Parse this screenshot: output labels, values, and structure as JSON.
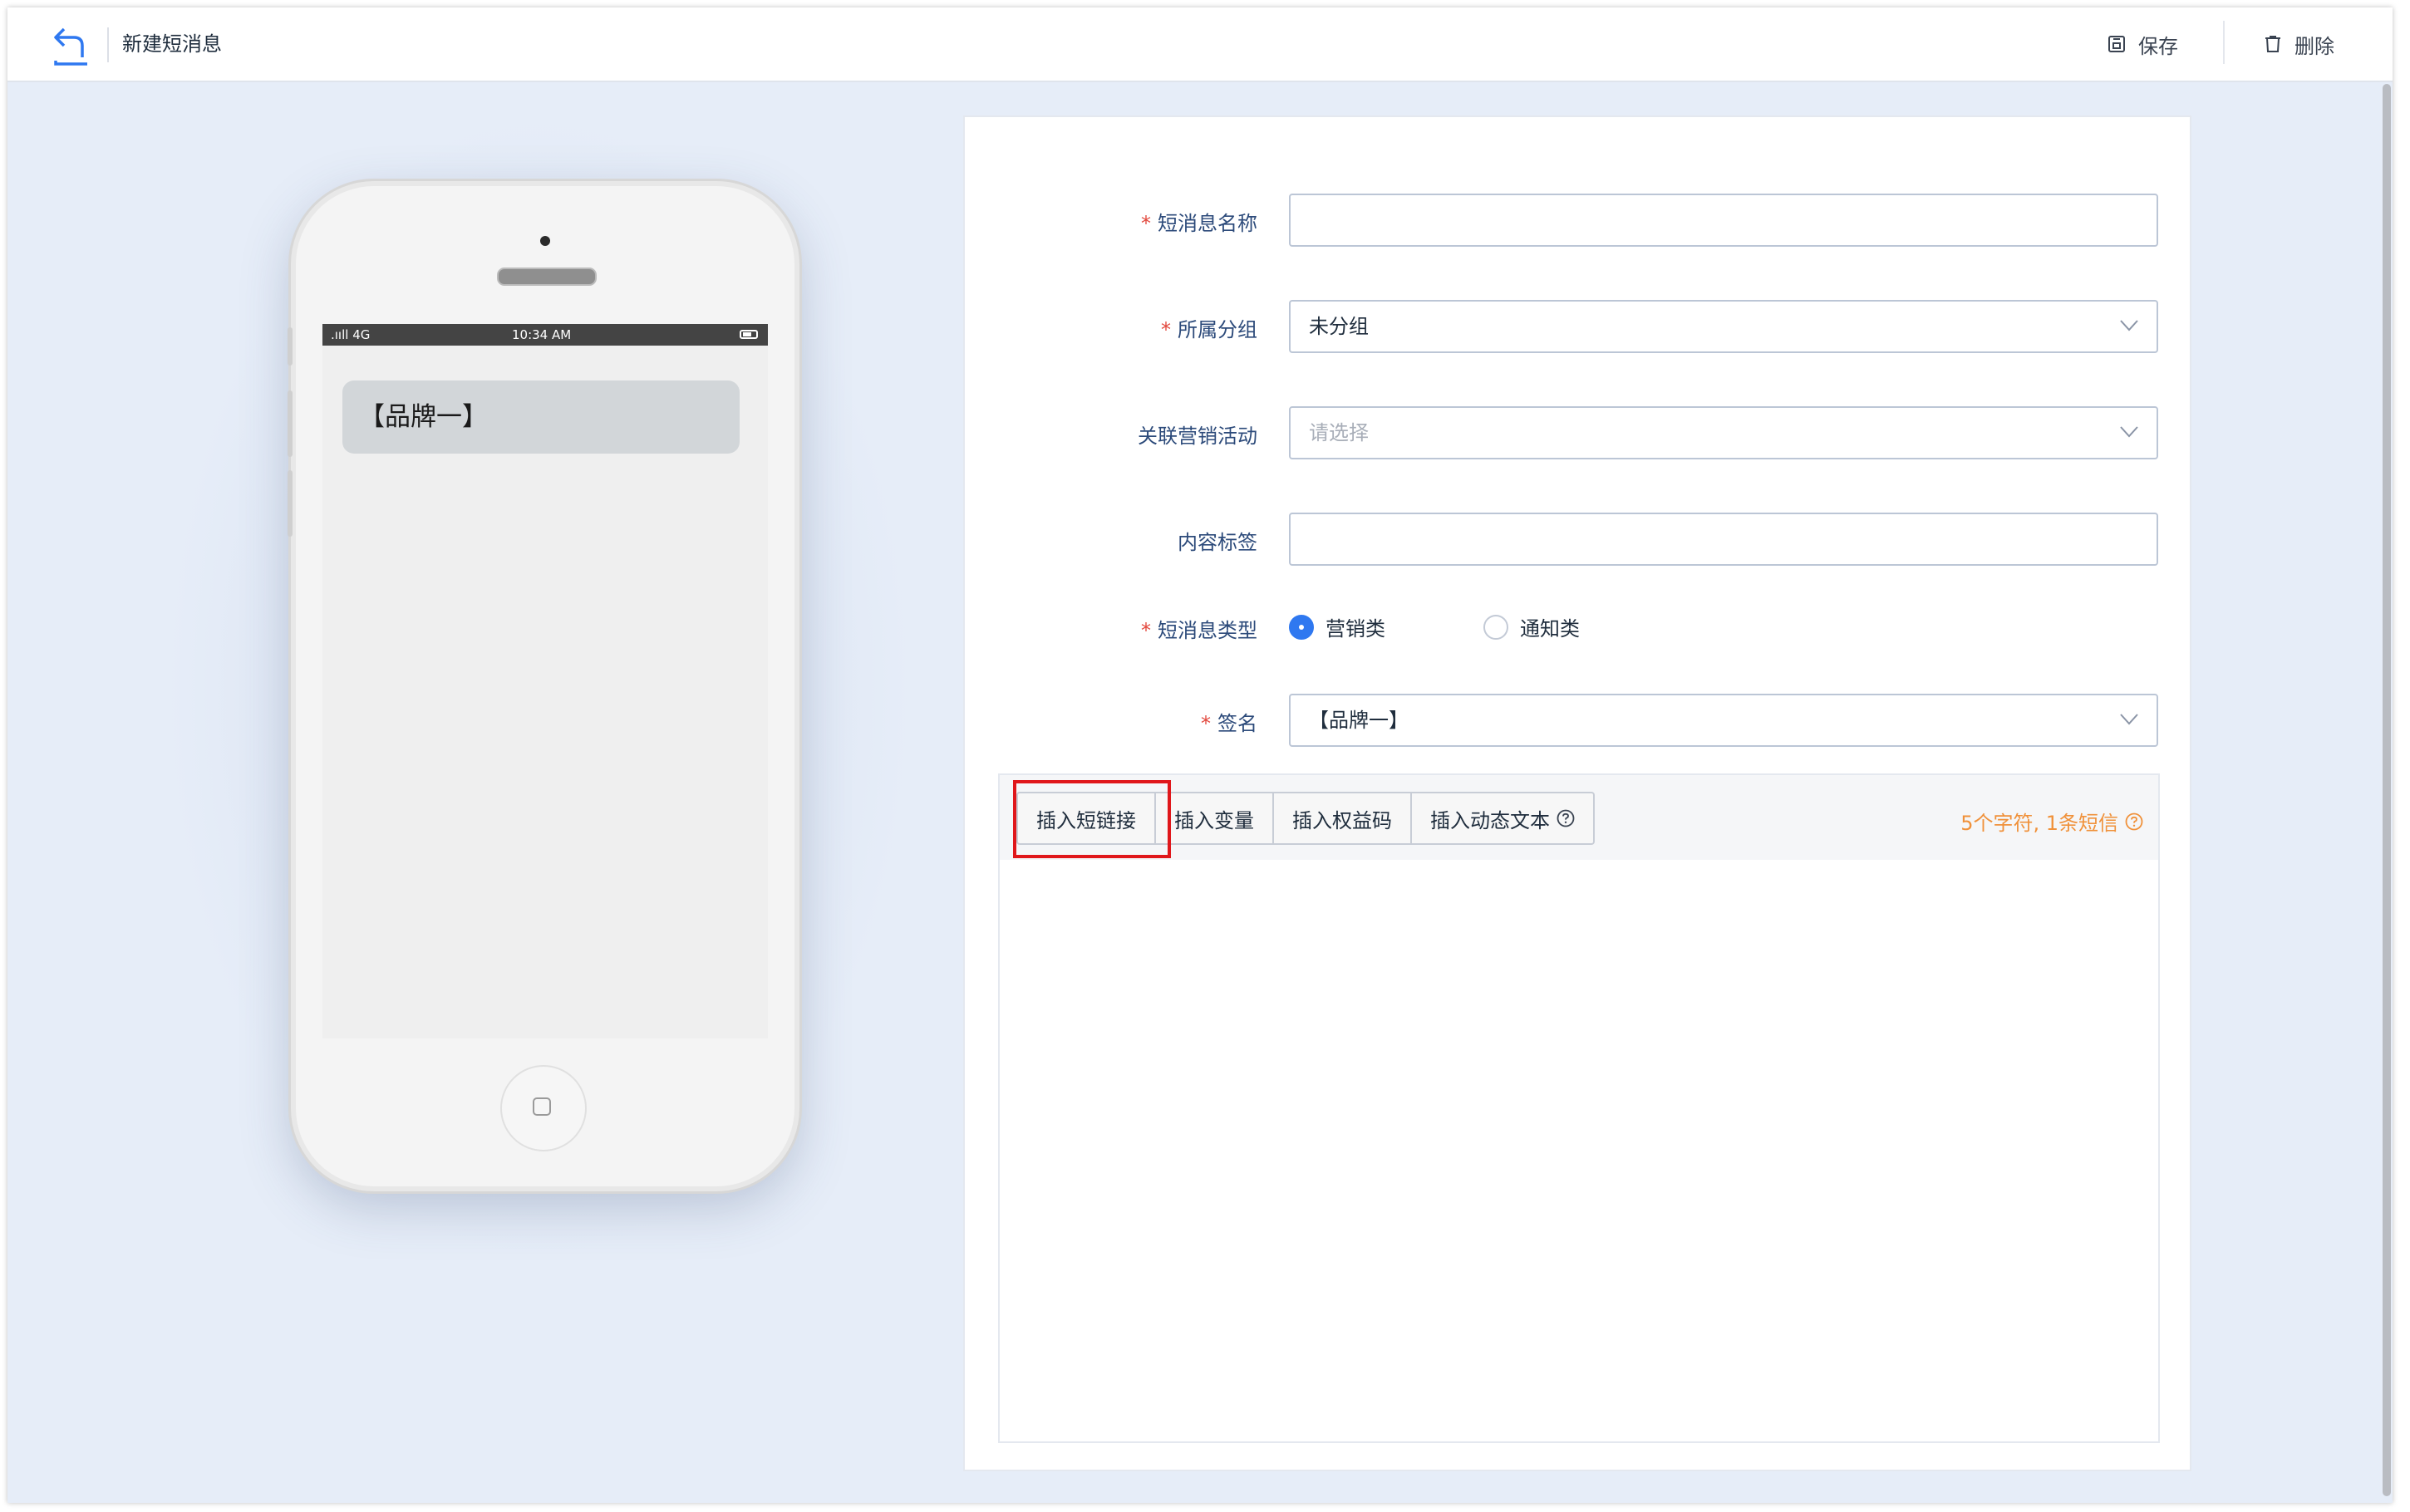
{
  "header": {
    "title": "新建短消息",
    "save_label": "保存",
    "delete_label": "删除"
  },
  "phone": {
    "status_signal": ".ııll 4G",
    "status_time": "10:34 AM",
    "message_text": "【品牌一】"
  },
  "form": {
    "name": {
      "label": "短消息名称",
      "required": "*",
      "value": ""
    },
    "group": {
      "label": "所属分组",
      "required": "*",
      "value": "未分组"
    },
    "campaign": {
      "label": "关联营销活动",
      "placeholder": "请选择"
    },
    "tag": {
      "label": "内容标签",
      "value": ""
    },
    "type": {
      "label": "短消息类型",
      "required": "*",
      "options": [
        {
          "label": "营销类",
          "checked": true
        },
        {
          "label": "通知类",
          "checked": false
        }
      ]
    },
    "signature": {
      "label": "签名",
      "required": "*",
      "value": "【品牌一】"
    }
  },
  "editor": {
    "buttons": [
      "插入短链接",
      "插入变量",
      "插入权益码",
      "插入动态文本"
    ],
    "counter": "5个字符, 1条短信",
    "content": ""
  },
  "colors": {
    "accent": "#2f78f0",
    "required": "#e2473c",
    "counter": "#f0913a",
    "highlight": "#e0171b",
    "background": "#e6edf8"
  }
}
